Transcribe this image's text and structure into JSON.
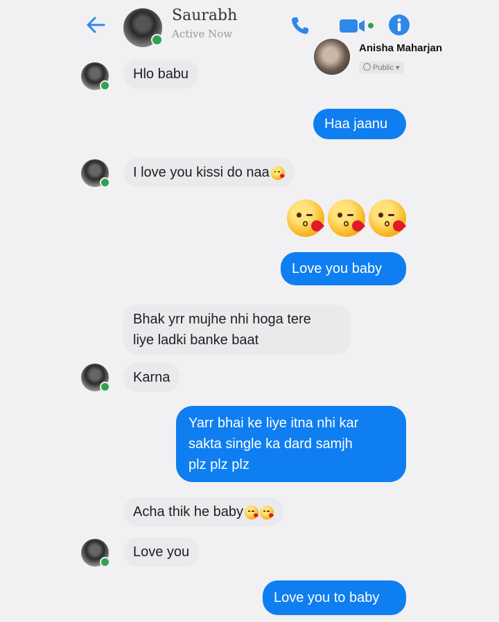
{
  "header": {
    "contact_name": "Saurabh",
    "status": "Active Now"
  },
  "overlay": {
    "name": "Anisha Maharjan",
    "privacy": "Public"
  },
  "messages": [
    {
      "from": "them",
      "text": "Hlo babu"
    },
    {
      "from": "me",
      "text": "Haa jaanu"
    },
    {
      "from": "them",
      "text": "I love you kissi do naa"
    },
    {
      "from": "me",
      "text": "Love you baby"
    },
    {
      "from": "them",
      "line1": "Bhak yrr mujhe nhi hoga tere",
      "line2": "liye ladki banke baat"
    },
    {
      "from": "them",
      "text": "Karna"
    },
    {
      "from": "me",
      "line1": "Yarr bhai ke liye itna nhi kar",
      "line2": "sakta single ka dard samjh",
      "line3": "plz plz plz"
    },
    {
      "from": "them",
      "text": "Acha thik he baby"
    },
    {
      "from": "them",
      "text": "Love you"
    },
    {
      "from": "me",
      "text": "Love you to baby"
    }
  ],
  "icons": {
    "back": "arrow-left-icon",
    "call": "phone-icon",
    "video": "video-camera-icon",
    "info": "info-icon",
    "emoji": "face-blowing-kiss"
  },
  "colors": {
    "accent": "#0f7ef0",
    "incoming_bubble": "#eaeaec",
    "online": "#31a24c",
    "background": "#f1f1f3"
  }
}
